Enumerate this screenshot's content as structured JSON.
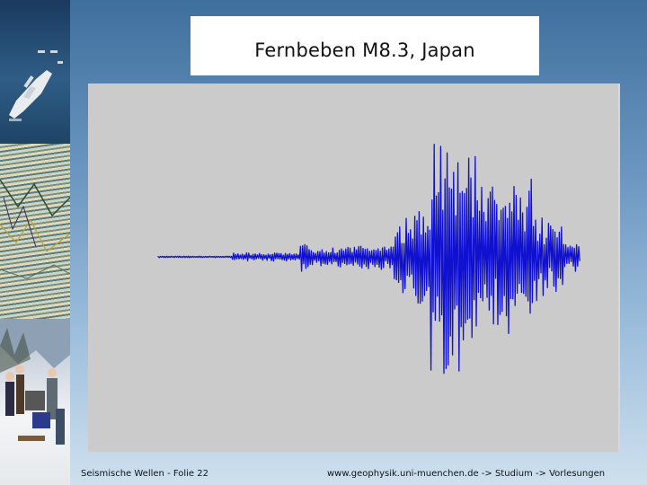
{
  "slide": {
    "title": "Fernbeben M8.3, Japan",
    "footer_left": "Seismische Wellen - Folie 22",
    "footer_right": "www.geophysik.uni-muenchen.de -> Studium -> Vorlesungen"
  },
  "colors": {
    "seismogram": "#1010d0",
    "plot_background": "#cbcbcb",
    "title_background": "#ffffff"
  },
  "icons": {
    "sidebar_photos": [
      "research-ship-photo",
      "seismic-section-photo",
      "snow-field-crew-photo"
    ]
  }
}
